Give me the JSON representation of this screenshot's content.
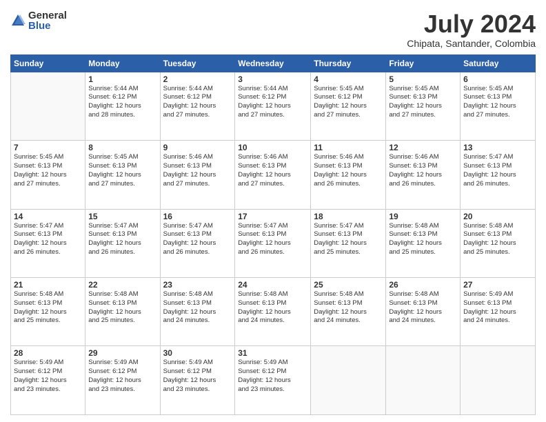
{
  "logo": {
    "general": "General",
    "blue": "Blue"
  },
  "title": "July 2024",
  "location": "Chipata, Santander, Colombia",
  "days_of_week": [
    "Sunday",
    "Monday",
    "Tuesday",
    "Wednesday",
    "Thursday",
    "Friday",
    "Saturday"
  ],
  "weeks": [
    [
      {
        "day": "",
        "info": ""
      },
      {
        "day": "1",
        "info": "Sunrise: 5:44 AM\nSunset: 6:12 PM\nDaylight: 12 hours\nand 28 minutes."
      },
      {
        "day": "2",
        "info": "Sunrise: 5:44 AM\nSunset: 6:12 PM\nDaylight: 12 hours\nand 27 minutes."
      },
      {
        "day": "3",
        "info": "Sunrise: 5:44 AM\nSunset: 6:12 PM\nDaylight: 12 hours\nand 27 minutes."
      },
      {
        "day": "4",
        "info": "Sunrise: 5:45 AM\nSunset: 6:12 PM\nDaylight: 12 hours\nand 27 minutes."
      },
      {
        "day": "5",
        "info": "Sunrise: 5:45 AM\nSunset: 6:13 PM\nDaylight: 12 hours\nand 27 minutes."
      },
      {
        "day": "6",
        "info": "Sunrise: 5:45 AM\nSunset: 6:13 PM\nDaylight: 12 hours\nand 27 minutes."
      }
    ],
    [
      {
        "day": "7",
        "info": "Sunrise: 5:45 AM\nSunset: 6:13 PM\nDaylight: 12 hours\nand 27 minutes."
      },
      {
        "day": "8",
        "info": "Sunrise: 5:45 AM\nSunset: 6:13 PM\nDaylight: 12 hours\nand 27 minutes."
      },
      {
        "day": "9",
        "info": "Sunrise: 5:46 AM\nSunset: 6:13 PM\nDaylight: 12 hours\nand 27 minutes."
      },
      {
        "day": "10",
        "info": "Sunrise: 5:46 AM\nSunset: 6:13 PM\nDaylight: 12 hours\nand 27 minutes."
      },
      {
        "day": "11",
        "info": "Sunrise: 5:46 AM\nSunset: 6:13 PM\nDaylight: 12 hours\nand 26 minutes."
      },
      {
        "day": "12",
        "info": "Sunrise: 5:46 AM\nSunset: 6:13 PM\nDaylight: 12 hours\nand 26 minutes."
      },
      {
        "day": "13",
        "info": "Sunrise: 5:47 AM\nSunset: 6:13 PM\nDaylight: 12 hours\nand 26 minutes."
      }
    ],
    [
      {
        "day": "14",
        "info": "Sunrise: 5:47 AM\nSunset: 6:13 PM\nDaylight: 12 hours\nand 26 minutes."
      },
      {
        "day": "15",
        "info": "Sunrise: 5:47 AM\nSunset: 6:13 PM\nDaylight: 12 hours\nand 26 minutes."
      },
      {
        "day": "16",
        "info": "Sunrise: 5:47 AM\nSunset: 6:13 PM\nDaylight: 12 hours\nand 26 minutes."
      },
      {
        "day": "17",
        "info": "Sunrise: 5:47 AM\nSunset: 6:13 PM\nDaylight: 12 hours\nand 26 minutes."
      },
      {
        "day": "18",
        "info": "Sunrise: 5:47 AM\nSunset: 6:13 PM\nDaylight: 12 hours\nand 25 minutes."
      },
      {
        "day": "19",
        "info": "Sunrise: 5:48 AM\nSunset: 6:13 PM\nDaylight: 12 hours\nand 25 minutes."
      },
      {
        "day": "20",
        "info": "Sunrise: 5:48 AM\nSunset: 6:13 PM\nDaylight: 12 hours\nand 25 minutes."
      }
    ],
    [
      {
        "day": "21",
        "info": "Sunrise: 5:48 AM\nSunset: 6:13 PM\nDaylight: 12 hours\nand 25 minutes."
      },
      {
        "day": "22",
        "info": "Sunrise: 5:48 AM\nSunset: 6:13 PM\nDaylight: 12 hours\nand 25 minutes."
      },
      {
        "day": "23",
        "info": "Sunrise: 5:48 AM\nSunset: 6:13 PM\nDaylight: 12 hours\nand 24 minutes."
      },
      {
        "day": "24",
        "info": "Sunrise: 5:48 AM\nSunset: 6:13 PM\nDaylight: 12 hours\nand 24 minutes."
      },
      {
        "day": "25",
        "info": "Sunrise: 5:48 AM\nSunset: 6:13 PM\nDaylight: 12 hours\nand 24 minutes."
      },
      {
        "day": "26",
        "info": "Sunrise: 5:48 AM\nSunset: 6:13 PM\nDaylight: 12 hours\nand 24 minutes."
      },
      {
        "day": "27",
        "info": "Sunrise: 5:49 AM\nSunset: 6:13 PM\nDaylight: 12 hours\nand 24 minutes."
      }
    ],
    [
      {
        "day": "28",
        "info": "Sunrise: 5:49 AM\nSunset: 6:12 PM\nDaylight: 12 hours\nand 23 minutes."
      },
      {
        "day": "29",
        "info": "Sunrise: 5:49 AM\nSunset: 6:12 PM\nDaylight: 12 hours\nand 23 minutes."
      },
      {
        "day": "30",
        "info": "Sunrise: 5:49 AM\nSunset: 6:12 PM\nDaylight: 12 hours\nand 23 minutes."
      },
      {
        "day": "31",
        "info": "Sunrise: 5:49 AM\nSunset: 6:12 PM\nDaylight: 12 hours\nand 23 minutes."
      },
      {
        "day": "",
        "info": ""
      },
      {
        "day": "",
        "info": ""
      },
      {
        "day": "",
        "info": ""
      }
    ]
  ]
}
